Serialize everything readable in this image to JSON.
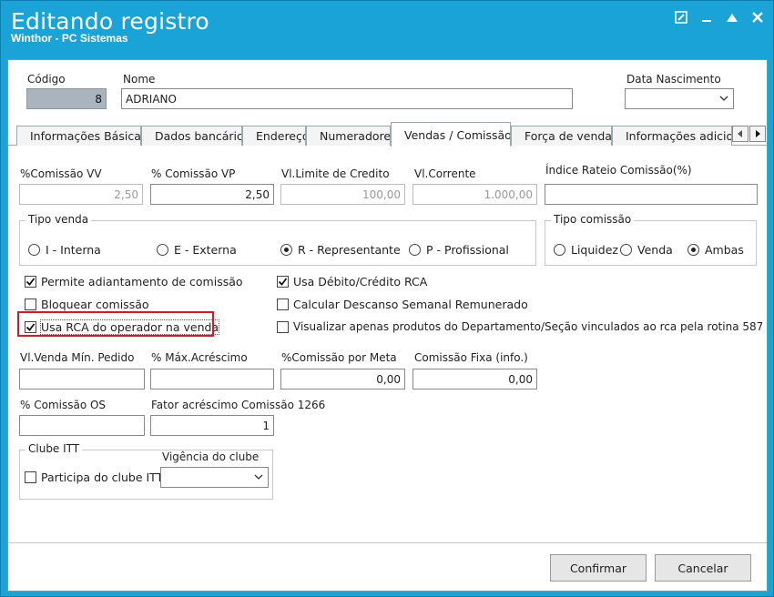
{
  "window": {
    "title": "Editando registro",
    "subtitle": "Winthor - PC Sistemas"
  },
  "header": {
    "codigo_label": "Código",
    "codigo_value": "8",
    "nome_label": "Nome",
    "nome_value": "ADRIANO",
    "data_nasc_label": "Data Nascimento",
    "data_nasc_value": ""
  },
  "tabs": [
    {
      "label": "Informações Básicas"
    },
    {
      "label": "Dados bancários"
    },
    {
      "label": "Endereço"
    },
    {
      "label": "Numeradores"
    },
    {
      "label": "Vendas  / Comissão"
    },
    {
      "label": "Força de vendas"
    },
    {
      "label": "Informações adicionais"
    }
  ],
  "fields": {
    "comissao_vv_label": "%Comissão VV",
    "comissao_vv_value": "2,50",
    "comissao_vp_label": "% Comissão VP",
    "comissao_vp_value": "2,50",
    "limite_credito_label": "Vl.Limite de Credito",
    "limite_credito_value": "100,00",
    "vl_corrente_label": "Vl.Corrente",
    "vl_corrente_value": "1.000,00",
    "indice_rateio_label": "Índice Rateio Comissão(%)",
    "indice_rateio_value": "",
    "venda_min_label": "Vl.Venda Mín. Pedido",
    "venda_min_value": "",
    "max_acrescimo_label": "% Máx.Acréscimo",
    "max_acrescimo_value": "",
    "comissao_meta_label": "%Comissão por Meta",
    "comissao_meta_value": "0,00",
    "comissao_fixa_label": "Comissão Fixa (info.)",
    "comissao_fixa_value": "0,00",
    "comissao_os_label": "% Comissão OS",
    "comissao_os_value": "",
    "fator_acrescimo_label": "Fator acréscimo Comissão 1266",
    "fator_acrescimo_value": "1"
  },
  "tipo_venda": {
    "title": "Tipo venda",
    "options": [
      "I - Interna",
      "E - Externa",
      "R - Representante",
      "P - Profissional"
    ],
    "selected": "R - Representante"
  },
  "tipo_comissao": {
    "title": "Tipo comissão",
    "options": [
      "Liquidez",
      "Venda",
      "Ambas"
    ],
    "selected": "Ambas"
  },
  "checks": {
    "adiantamento": {
      "label": "Permite adiantamento de comissão",
      "checked": true
    },
    "bloquear": {
      "label": "Bloquear comissão",
      "checked": false
    },
    "usa_rca": {
      "label": "Usa RCA do operador na venda",
      "checked": true
    },
    "debito_credito": {
      "label": "Usa Débito/Crédito RCA",
      "checked": true
    },
    "dsr": {
      "label": "Calcular Descanso Semanal Remunerado",
      "checked": false
    },
    "visualizar_produtos": {
      "label": "Visualizar apenas produtos do Departamento/Seção vinculados ao rca pela rotina 587",
      "checked": false
    }
  },
  "clube": {
    "title": "Clube ITT",
    "vigencia_label": "Vigência do clube",
    "vigencia_value": "",
    "participa_label": "Participa do clube ITT",
    "participa_checked": false
  },
  "buttons": {
    "confirmar": "Confirmar",
    "cancelar": "Cancelar"
  }
}
